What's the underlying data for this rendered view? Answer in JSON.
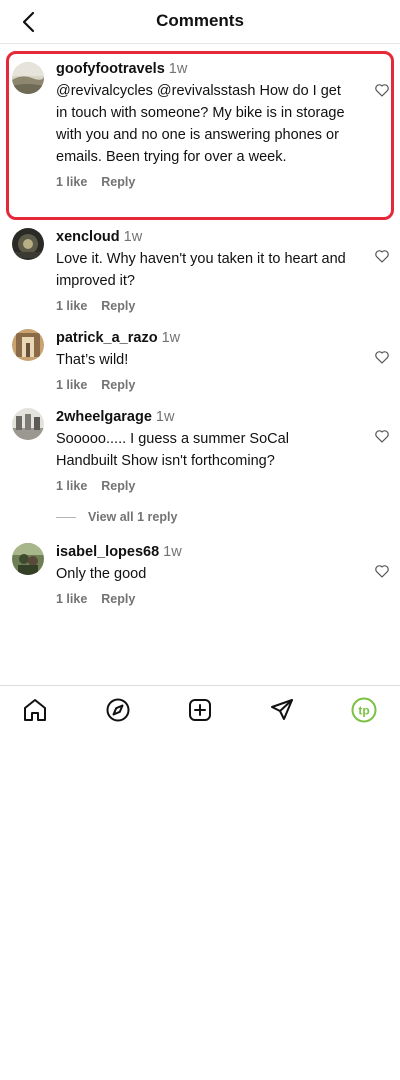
{
  "header": {
    "title": "Comments"
  },
  "comments": [
    {
      "username": "goofyfootravels",
      "time": "1w",
      "text": "@revivalcycles @revivalsstash How do I get in touch with someone? My bike is in storage with you and no one is answering phones or emails. Been trying for over a week.",
      "likes": "1 like",
      "reply": "Reply"
    },
    {
      "username": "xencloud",
      "time": "1w",
      "text": "Love it. Why haven't you taken it to heart and improved it?",
      "likes": "1 like",
      "reply": "Reply"
    },
    {
      "username": "patrick_a_razo",
      "time": "1w",
      "text": "That’s wild!",
      "likes": "1 like",
      "reply": "Reply"
    },
    {
      "username": "2wheelgarage",
      "time": "1w",
      "text": "Sooooo..... I guess a summer SoCal Handbuilt Show isn't forthcoming?",
      "likes": "1 like",
      "reply": "Reply",
      "view_replies": "View all 1 reply"
    },
    {
      "username": "isabel_lopes68",
      "time": "1w",
      "text": "Only the good",
      "likes": "1 like",
      "reply": "Reply"
    }
  ],
  "highlight_color": "#e5283a",
  "tabbar": {
    "icons": [
      "home-icon",
      "explore-icon",
      "create-post-icon",
      "direct-messages-icon",
      "profile-avatar"
    ],
    "profile_avatar_text": "tp",
    "profile_avatar_color": "#7cc242"
  }
}
